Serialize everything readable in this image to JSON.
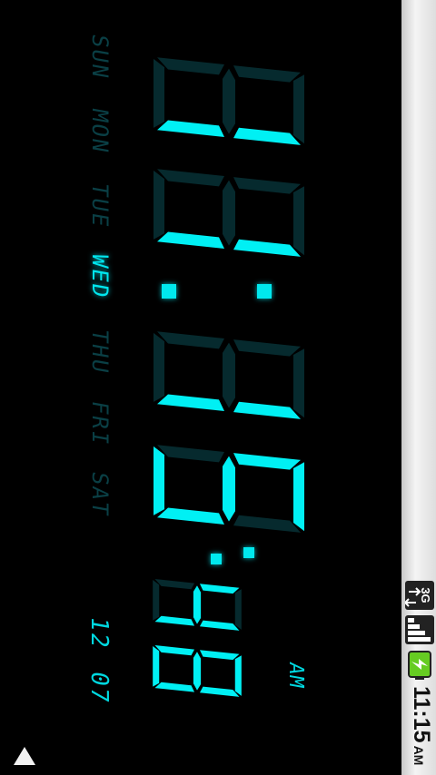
{
  "days": [
    {
      "label": "SUN",
      "active": false
    },
    {
      "label": "MON",
      "active": false
    },
    {
      "label": "TUE",
      "active": false
    },
    {
      "label": "WED",
      "active": true
    },
    {
      "label": "THU",
      "active": false
    },
    {
      "label": "FRI",
      "active": false
    },
    {
      "label": "SAT",
      "active": false
    }
  ],
  "time": {
    "hours": "11",
    "minutes": "15",
    "seconds": "48",
    "ampm": "AM"
  },
  "date": {
    "month": "12",
    "day": "07"
  },
  "status_bar": {
    "network": "3G",
    "time": "11:15",
    "ampm": "AM"
  },
  "colors": {
    "accent": "#00f0f4",
    "dim": "#062a2e",
    "battery": "#66cc22"
  }
}
